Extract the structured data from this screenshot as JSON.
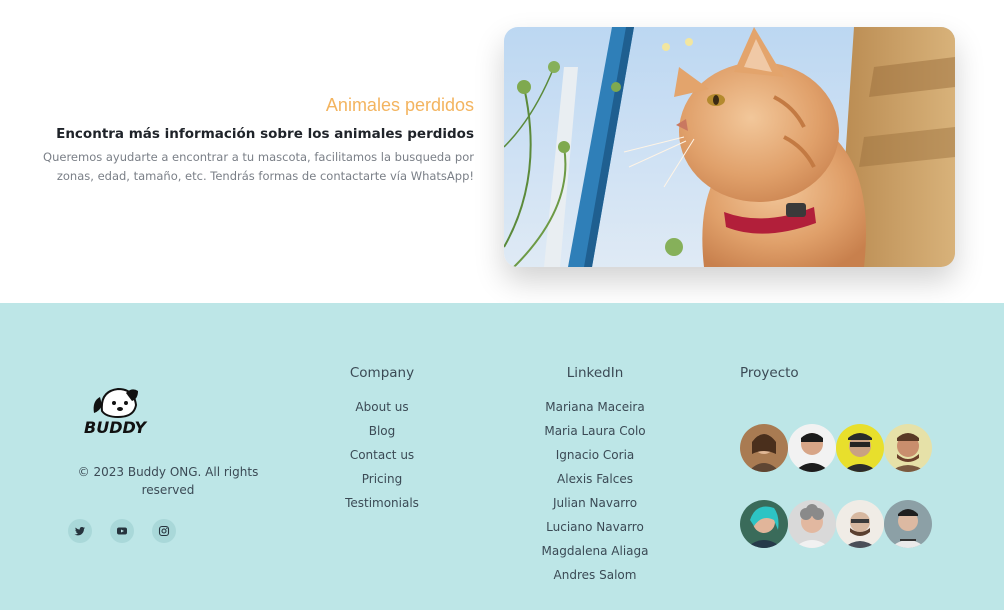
{
  "feature": {
    "title": "Animales perdidos",
    "subtitle": "Encontra más información sobre los animales perdidos",
    "description": "Queremos ayudarte a encontrar a tu mascota, facilitamos la busqueda por zonas, edad, tamaño, etc. Tendrás formas de contactarte vía WhatsApp!",
    "image_icon": "orange-cat-photo"
  },
  "footer": {
    "background": "#bde6e7",
    "brand": {
      "logo_icon": "buddy-dog-cat-logo",
      "logo_text": "BUDDY",
      "copyright": "© 2023 Buddy ONG. All rights reserved"
    },
    "social": [
      {
        "icon": "twitter-icon"
      },
      {
        "icon": "youtube-icon"
      },
      {
        "icon": "instagram-icon"
      }
    ],
    "company": {
      "title": "Company",
      "links": [
        "About us",
        "Blog",
        "Contact us",
        "Pricing",
        "Testimonials"
      ]
    },
    "linkedin": {
      "title": "LinkedIn",
      "links": [
        "Mariana Maceira",
        "Maria Laura Colo",
        "Ignacio Coria",
        "Alexis Falces",
        "Julian Navarro",
        "Luciano Navarro",
        "Magdalena Aliaga",
        "Andres Salom"
      ]
    },
    "proyecto": {
      "title": "Proyecto"
    }
  },
  "colors": {
    "accent": "#f3b45f",
    "footer_bg": "#bde6e7",
    "text": "#3b4a55"
  }
}
